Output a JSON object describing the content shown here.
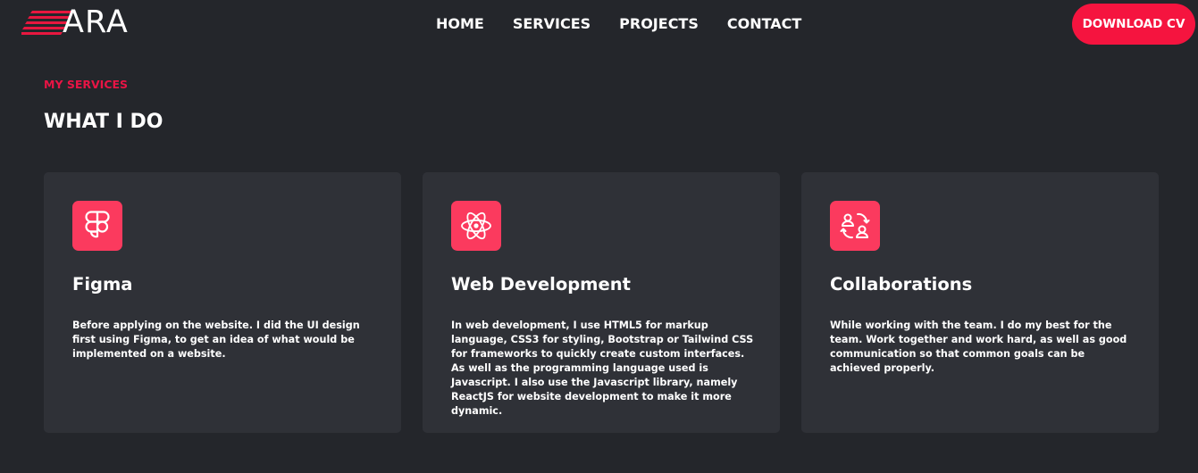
{
  "brand": {
    "logo_text": "ARA",
    "accent_color": "#f5143f"
  },
  "nav": {
    "items": [
      "HOME",
      "SERVICES",
      "PROJECTS",
      "CONTACT"
    ],
    "cta_label": "DOWNLOAD CV"
  },
  "section": {
    "eyebrow": "MY SERVICES",
    "title": "WHAT I DO"
  },
  "cards": [
    {
      "icon": "figma-icon",
      "title": "Figma",
      "description": "Before applying on the website. I did the UI design first using Figma, to get an idea of what would be implemented on a website."
    },
    {
      "icon": "react-icon",
      "title": "Web Development",
      "description": "In web development, I use HTML5 for markup language, CSS3 for styling, Bootstrap or Tailwind CSS for frameworks to quickly create custom interfaces. As well as the programming language used is Javascript. I also use the Javascript library, namely ReactJS for website development to make it more dynamic."
    },
    {
      "icon": "user-swap-icon",
      "title": "Collaborations",
      "description": "While working with the team. I do my best for the team. Work together and work hard, as well as good communication so that common goals can be achieved properly."
    }
  ]
}
